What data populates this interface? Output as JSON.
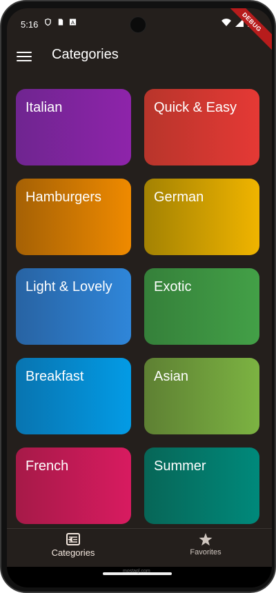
{
  "status_bar": {
    "time": "5:16",
    "debug_banner": "DEBUG"
  },
  "app_bar": {
    "title": "Categories",
    "menu_icon": "hamburger-menu-icon"
  },
  "categories": [
    {
      "label": "Italian",
      "colors": [
        "#6f2590",
        "#8e24aa"
      ]
    },
    {
      "label": "Quick & Easy",
      "colors": [
        "#b8352b",
        "#e53935"
      ]
    },
    {
      "label": "Hamburgers",
      "colors": [
        "#a56105",
        "#ef8a00"
      ]
    },
    {
      "label": "German",
      "colors": [
        "#a38203",
        "#f0b400"
      ]
    },
    {
      "label": "Light & Lovely",
      "colors": [
        "#2863a3",
        "#2f86d9"
      ]
    },
    {
      "label": "Exotic",
      "colors": [
        "#35803a",
        "#43a047"
      ]
    },
    {
      "label": "Breakfast",
      "colors": [
        "#0874b0",
        "#039be5"
      ]
    },
    {
      "label": "Asian",
      "colors": [
        "#5e8033",
        "#7cb342"
      ]
    },
    {
      "label": "French",
      "colors": [
        "#a61a48",
        "#d81b60"
      ]
    },
    {
      "label": "Summer",
      "colors": [
        "#076657",
        "#00897b"
      ]
    }
  ],
  "bottom_nav": {
    "categories_label": "Categories",
    "favorites_label": "Favorites",
    "active": "Categories"
  },
  "watermark": "mostaql.com"
}
